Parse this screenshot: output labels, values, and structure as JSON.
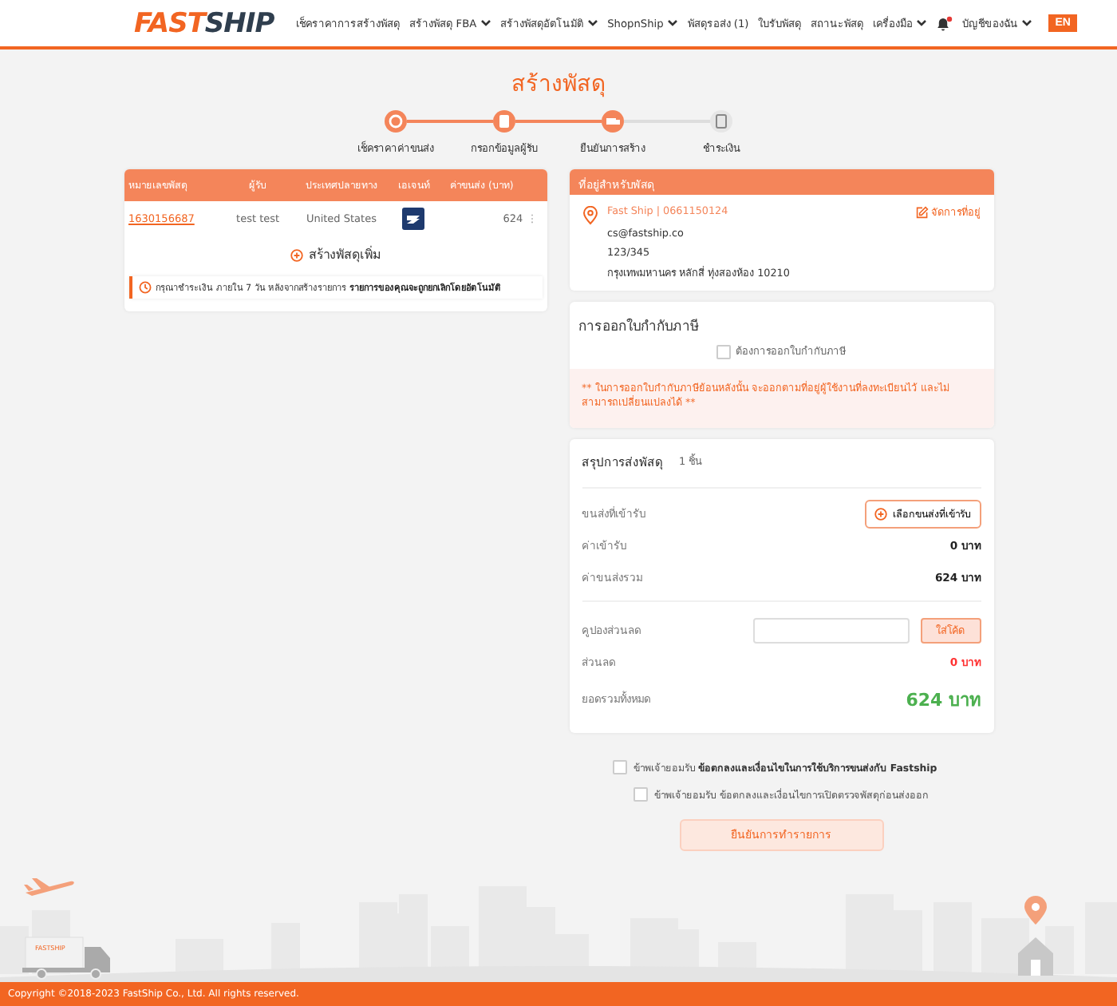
{
  "header": {
    "logo": {
      "first": "FAST",
      "second": "SHIP"
    },
    "nav": [
      {
        "label": "เช็คราคาการสร้างพัสดุ",
        "dropdown": false
      },
      {
        "label": "สร้างพัสดุ FBA",
        "dropdown": true
      },
      {
        "label": "สร้างพัสดุอัตโนมัติ",
        "dropdown": true
      },
      {
        "label": "ShopnShip",
        "dropdown": true
      },
      {
        "label": "พัสดุรอส่ง (1)",
        "dropdown": false
      },
      {
        "label": "ใบรับพัสดุ",
        "dropdown": false
      },
      {
        "label": "สถานะพัสดุ",
        "dropdown": false
      },
      {
        "label": "เครื่องมือ",
        "dropdown": true
      }
    ],
    "account": {
      "label": "บัญชีของฉัน",
      "dropdown": true,
      "notification": true
    },
    "language": "EN"
  },
  "title": "สร้างพัสดุ",
  "steps": [
    {
      "label": "เช็คราคาค่าขนส่ง",
      "done": true
    },
    {
      "label": "กรอกข้อมูลผู้รับ",
      "done": true
    },
    {
      "label": "ยืนยันการสร้าง",
      "done": true
    },
    {
      "label": "ชำระเงิน",
      "done": false
    }
  ],
  "parcels": {
    "columns": [
      "หมายเลขพัสดุ",
      "ผู้รับ",
      "ประเทศปลายทาง",
      "เอเจนท์",
      "ค่าขนส่ง (บาท)"
    ],
    "rows": [
      {
        "tracking": "1630156687",
        "recipient": "test test",
        "country": "United States",
        "cost": "624",
        "menu": "⋮"
      }
    ],
    "add_button": "สร้างพัสดุเพิ่ม",
    "notice": "กรุณาชำระเงิน ภายใน 7 วัน หลังจากสร้างรายการ **รายการของคุณจะถูกยกเลิกโดยอัตโนมัติ**"
  },
  "address": {
    "title": "ที่อยู่สำหรับพัสดุ",
    "name_phone": "Fast Ship | 0661150124",
    "manage": "จัดการที่อยู่",
    "lines": [
      "cs@fastship.co",
      "123/345",
      "กรุงเทพมหานคร หลักสี่ ทุ่งสองห้อง 10210"
    ]
  },
  "tax_invoice": {
    "title": "การออกใบกำกับภาษี",
    "option": {
      "label": "ต้องการออกใบกำกับภาษี",
      "checked": false
    },
    "warning": "** ในการออกใบกำกับภาษีย้อนหลังนั้น จะออกตามที่อยู่ผู้ใช้งานที่ลงทะเบียนไว้ และไม่สามารถเปลี่ยนแปลงได้ **"
  },
  "summary": {
    "title": "สรุปการส่งพัสดุ",
    "count": "1 ชิ้น",
    "rows": [
      {
        "kind": "pickup",
        "label": "ขนส่งที่เข้ารับ",
        "button": "เลือกขนส่งที่เข้ารับ"
      },
      {
        "kind": "amount",
        "label": "ค่าเข้ารับ",
        "value": "0 บาท"
      },
      {
        "kind": "amount",
        "label": "ค่าขนส่งรวม",
        "value": "624 บาท"
      },
      {
        "kind": "coupon",
        "label": "คูปองส่วนลด",
        "button": "ใส่โค้ด"
      },
      {
        "kind": "discount",
        "label": "ส่วนลด",
        "value": "0 บาท"
      },
      {
        "kind": "total",
        "label": "ยอดรวมทั้งหมด",
        "value": "624 บาท"
      }
    ]
  },
  "agreements": [
    {
      "text": "ข้าพเจ้ายอมรับ **ข้อตกลงและเงื่อนไขในการใช้บริการขนส่งกับ Fastship**",
      "checked": false
    },
    {
      "text": "ข้าพเจ้ายอมรับ ข้อตกลงและเงื่อนไขการเปิดตรวจพัสดุก่อนส่งออก",
      "checked": false
    }
  ],
  "confirm_button": "ยืนยันการทำรายการ",
  "footer": {
    "truck_label": "FASTSHIP",
    "copyright": "Copyright ©2018-2023 FastShip Co., Ltd. All rights reserved."
  }
}
